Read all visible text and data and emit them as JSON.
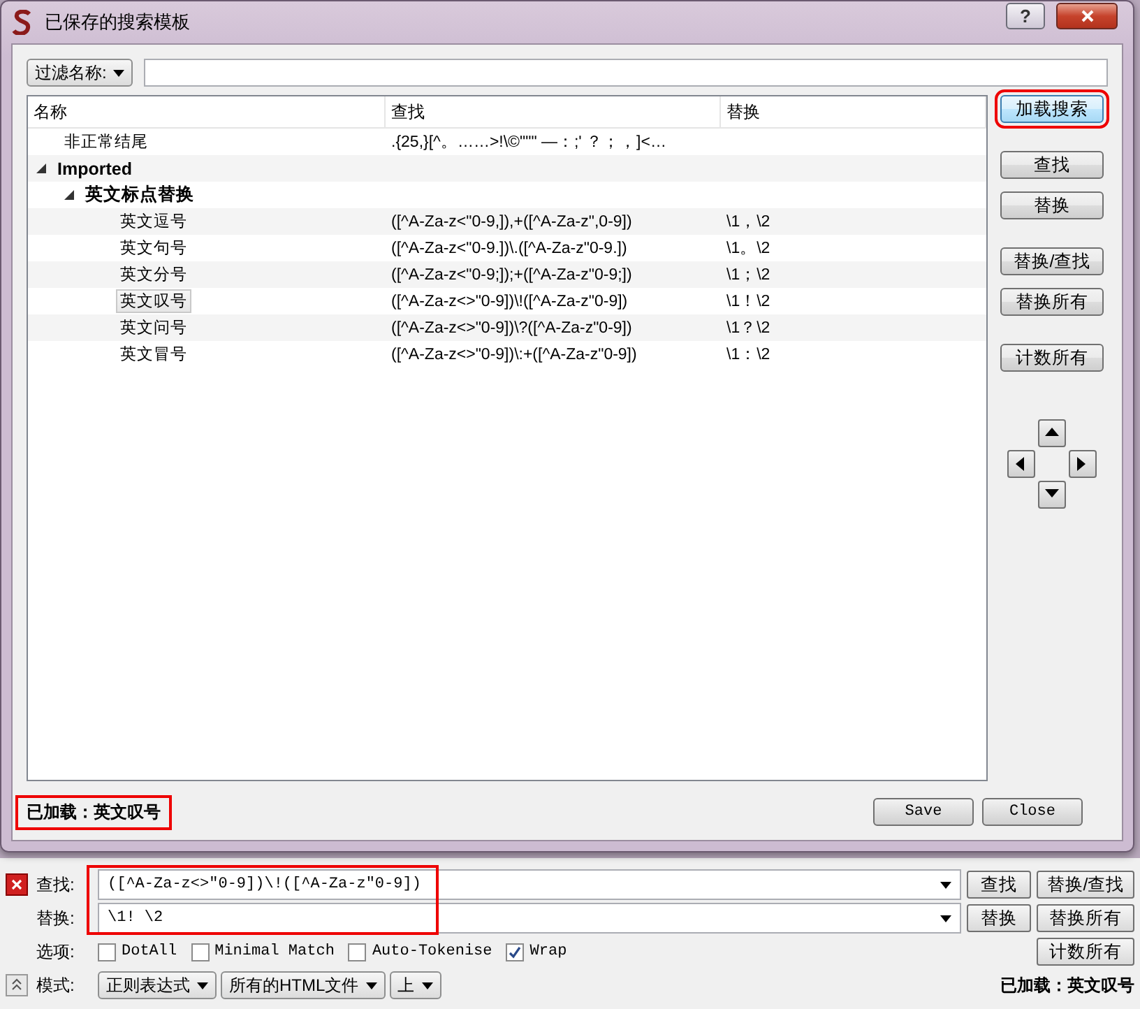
{
  "window": {
    "title": "已保存的搜索模板",
    "help": "?"
  },
  "filter": {
    "label": "过滤名称:"
  },
  "table": {
    "columns": [
      "名称",
      "查找",
      "替换"
    ],
    "rows": [
      {
        "name": "非正常结尾",
        "find": ".{25,}[^。……>!\\©\"\"\" —：;' ？；，]<…",
        "replace": "",
        "selected": false
      },
      {
        "name": "Imported",
        "expanded": true,
        "children": [
          {
            "name": "英文标点替换",
            "expanded": true,
            "children": [
              {
                "name": "英文逗号",
                "find": "([^A-Za-z<\"0-9,]),+([^A-Za-z\",0-9])",
                "replace": "\\1，\\2",
                "selected": false
              },
              {
                "name": "英文句号",
                "find": "([^A-Za-z<\"0-9.])\\.([^A-Za-z\"0-9.])",
                "replace": "\\1。\\2",
                "selected": false
              },
              {
                "name": "英文分号",
                "find": "([^A-Za-z<\"0-9;]);+([^A-Za-z\"0-9;])",
                "replace": "\\1；\\2",
                "selected": false
              },
              {
                "name": "英文叹号",
                "find": "([^A-Za-z<>\"0-9])\\!([^A-Za-z\"0-9])",
                "replace": "\\1！\\2",
                "selected": true
              },
              {
                "name": "英文问号",
                "find": "([^A-Za-z<>\"0-9])\\?([^A-Za-z\"0-9])",
                "replace": "\\1？\\2",
                "selected": false
              },
              {
                "name": "英文冒号",
                "find": "([^A-Za-z<>\"0-9])\\:+([^A-Za-z\"0-9])",
                "replace": "\\1：\\2",
                "selected": false
              }
            ]
          }
        ]
      }
    ]
  },
  "side_button_groups": [
    {
      "buttons": [
        {
          "label": "加载搜索",
          "highlighted": true
        }
      ]
    },
    {
      "buttons": [
        {
          "label": "查找",
          "highlighted": false
        },
        {
          "label": "替换",
          "highlighted": false
        }
      ]
    },
    {
      "buttons": [
        {
          "label": "替换/查找",
          "highlighted": false
        },
        {
          "label": "替换所有",
          "highlighted": false
        }
      ]
    },
    {
      "buttons": [
        {
          "label": "计数所有",
          "highlighted": false
        }
      ]
    }
  ],
  "dialog_status": {
    "text": "已加载：英文叹号",
    "highlighted": true
  },
  "dialog_buttons": [
    "Save",
    "Close"
  ],
  "find_bar": {
    "highlighted": true,
    "find": {
      "label": "查找:",
      "value": "([^A-Za-z<>\"0-9])\\!([^A-Za-z\"0-9])",
      "buttons": [
        "查找",
        "替换/查找"
      ]
    },
    "replace": {
      "label": "替换:",
      "value": "\\1! \\2",
      "buttons": [
        "替换",
        "替换所有"
      ]
    },
    "options_label": "选项:",
    "options": [
      {
        "label": "DotAll",
        "checked": false
      },
      {
        "label": "Minimal Match",
        "checked": false
      },
      {
        "label": "Auto-Tokenise",
        "checked": false
      },
      {
        "label": "Wrap",
        "checked": true
      }
    ],
    "count_button": "计数所有",
    "mode_label": "模式:",
    "dropdowns": [
      "正则表达式",
      "所有的HTML文件",
      "上"
    ],
    "status": "已加载：英文叹号"
  }
}
